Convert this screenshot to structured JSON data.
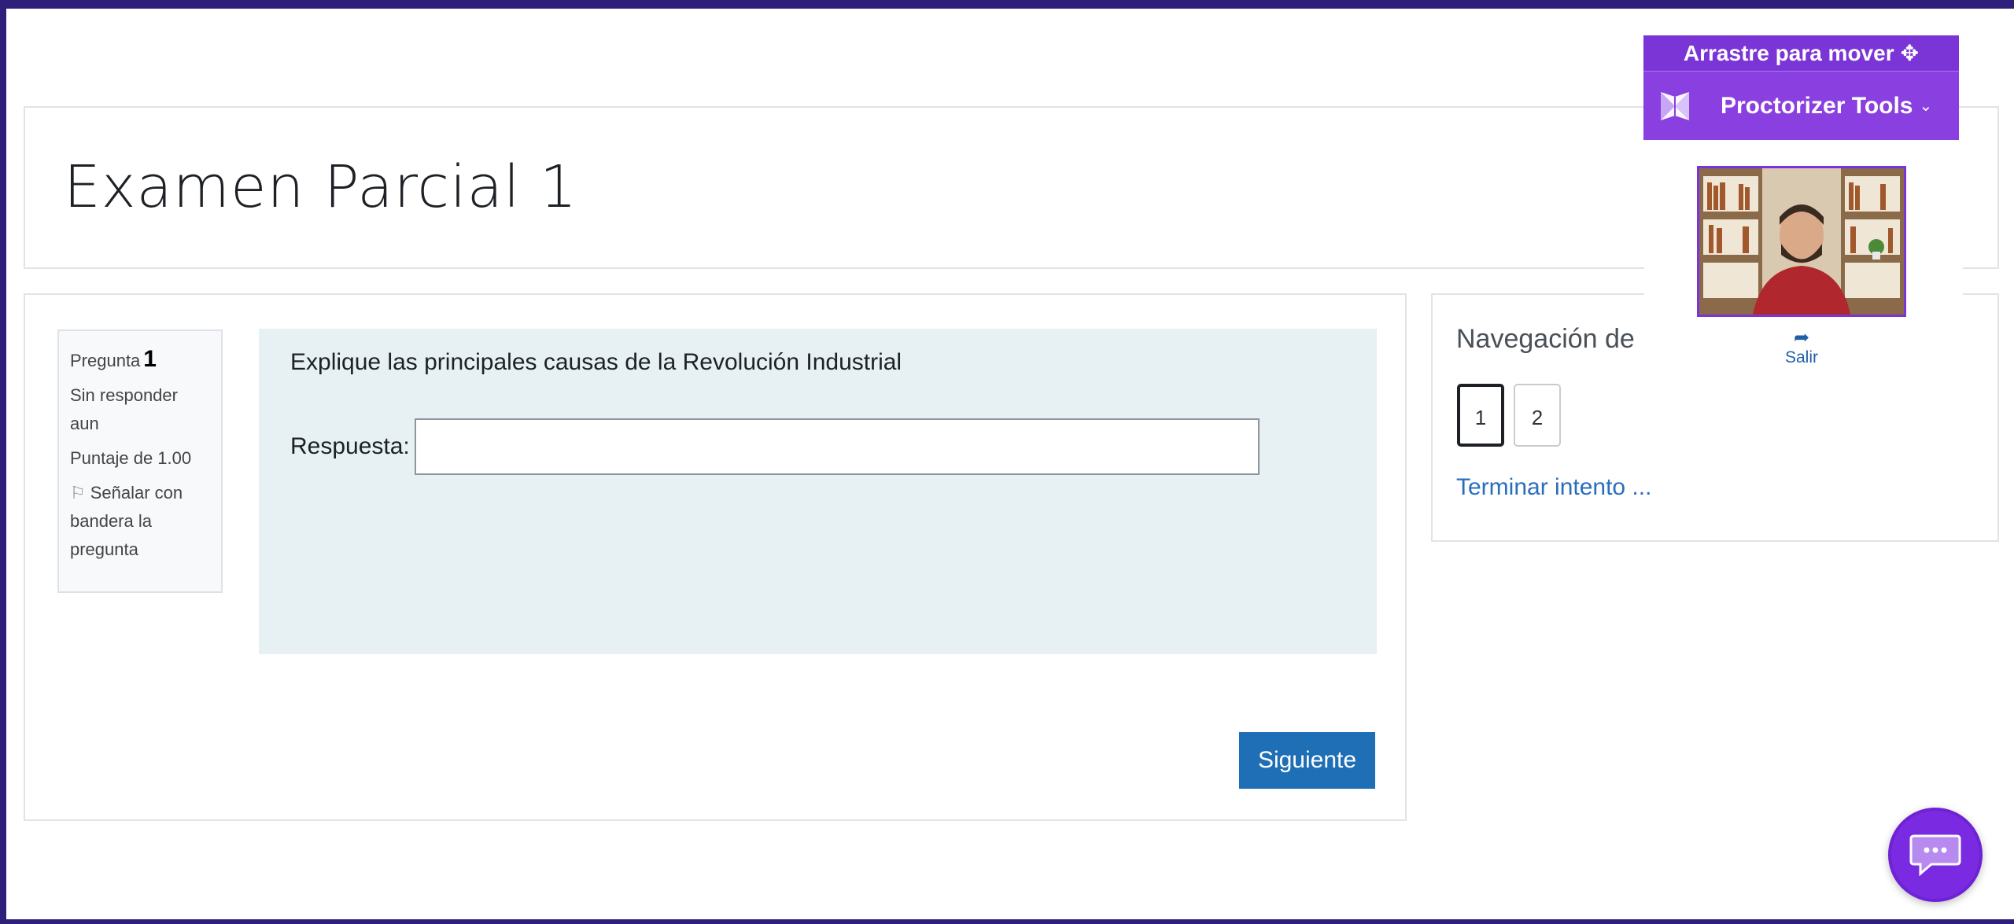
{
  "page": {
    "title": "Examen Parcial 1"
  },
  "question": {
    "label": "Pregunta",
    "number": "1",
    "status": "Sin responder aun",
    "score": "Puntaje de 1.00",
    "flag_label": "Señalar con bandera la pregunta",
    "text": "Explique las principales causas de la Revolución Industrial",
    "answer_label": "Respuesta:",
    "answer_value": ""
  },
  "actions": {
    "next_label": "Siguiente"
  },
  "navigation": {
    "title": "Navegación de",
    "buttons": [
      "1",
      "2"
    ],
    "finish_label": "Terminar intento ..."
  },
  "proctorizer": {
    "drag_label": "Arrastre para mover",
    "tools_label": "Proctorizer Tools",
    "exit_label": "Salir"
  },
  "colors": {
    "frame": "#2e1f7a",
    "proctor_purple": "#8a3fe0",
    "next_button": "#1f6fb7",
    "question_bg": "#e7f1f4",
    "link": "#2a6ebb"
  }
}
